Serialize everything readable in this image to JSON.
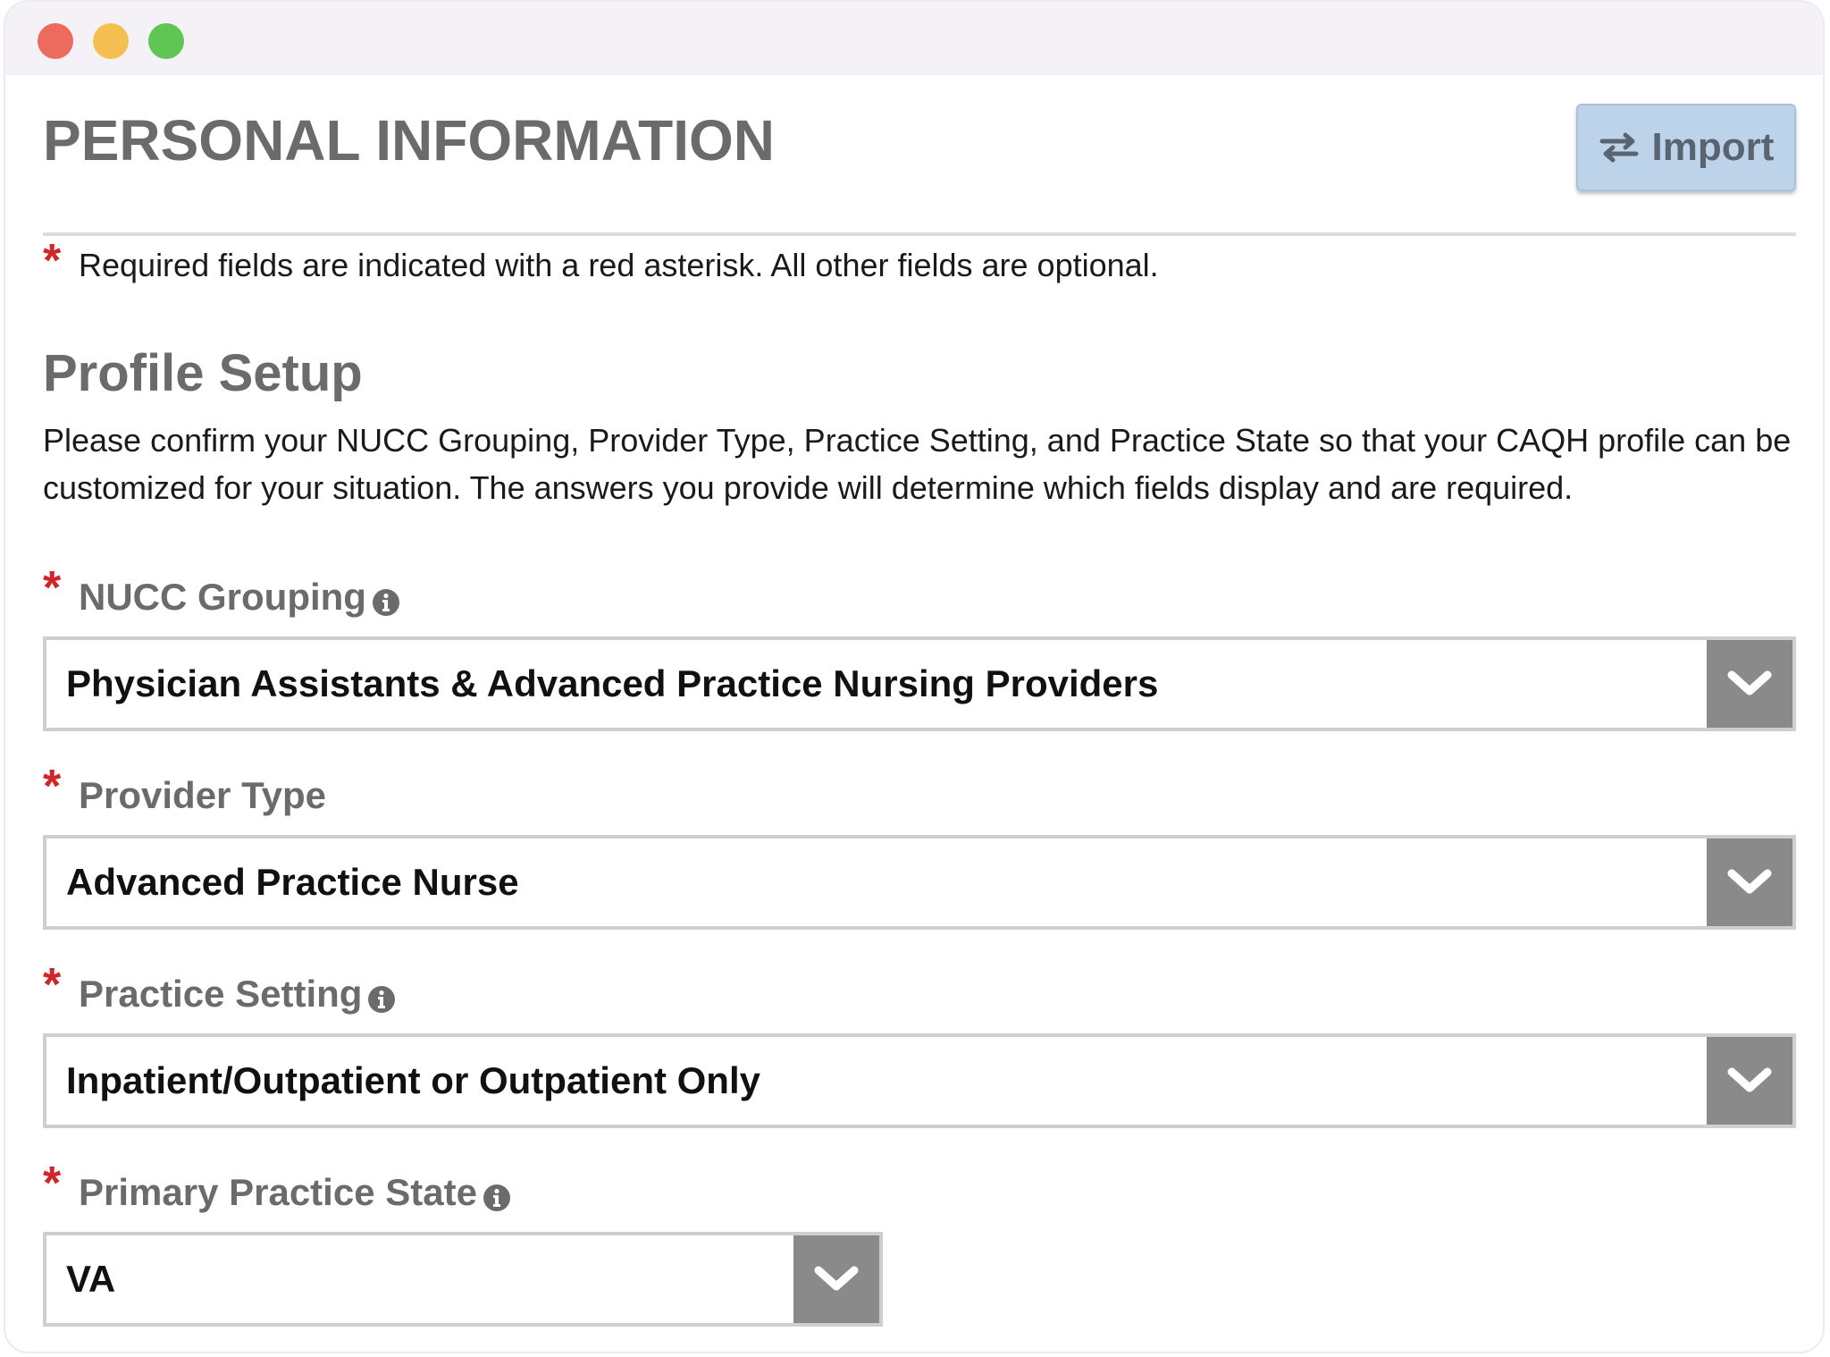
{
  "header": {
    "title": "PERSONAL INFORMATION",
    "import_label": "Import"
  },
  "required_note": {
    "asterisk": "*",
    "text": "Required fields are indicated with a red asterisk. All other fields are optional."
  },
  "section": {
    "title": "Profile Setup",
    "description": "Please confirm your NUCC Grouping, Provider Type, Practice Setting, and Practice State so that your CAQH profile can be customized for your situation. The answers you provide will determine which fields display and are required."
  },
  "fields": [
    {
      "label": "NUCC Grouping",
      "required_marker": "*",
      "has_info_icon": true,
      "value": "Physician Assistants & Advanced Practice Nursing Providers"
    },
    {
      "label": "Provider Type",
      "required_marker": "*",
      "has_info_icon": false,
      "value": "Advanced Practice Nurse"
    },
    {
      "label": "Practice Setting",
      "required_marker": "*",
      "has_info_icon": true,
      "value": "Inpatient/Outpatient or Outpatient Only"
    },
    {
      "label": "Primary Practice State",
      "required_marker": "*",
      "has_info_icon": true,
      "value": "VA"
    }
  ],
  "icons": {
    "import": "swap-arrows-icon",
    "info": "info-circle-icon",
    "dropdown": "chevron-down-icon"
  },
  "colors": {
    "required": "#d0262b",
    "import_button": "#bcd3ea",
    "dropdown_arrow_bg": "#8a8a8a",
    "heading_text": "#6b6b6b"
  }
}
